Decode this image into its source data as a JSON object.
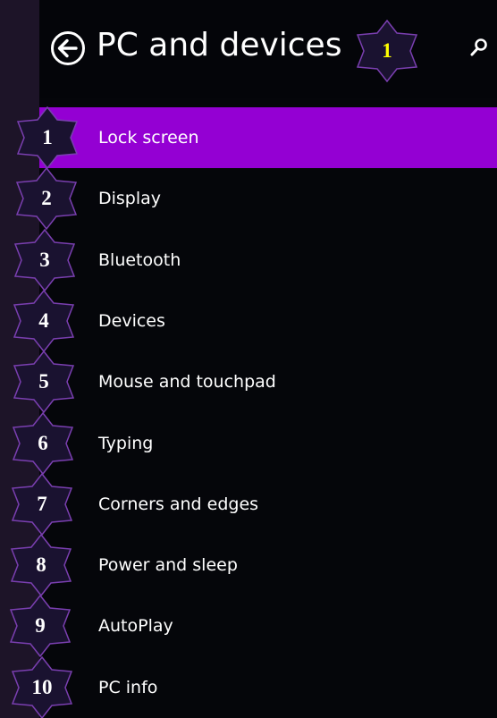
{
  "header": {
    "title": "PC and devices",
    "badge": "1"
  },
  "menu": {
    "items": [
      {
        "label": "Lock screen",
        "badge": "1",
        "selected": true
      },
      {
        "label": "Display",
        "badge": "2",
        "selected": false
      },
      {
        "label": "Bluetooth",
        "badge": "3",
        "selected": false
      },
      {
        "label": "Devices",
        "badge": "4",
        "selected": false
      },
      {
        "label": "Mouse and touchpad",
        "badge": "5",
        "selected": false
      },
      {
        "label": "Typing",
        "badge": "6",
        "selected": false
      },
      {
        "label": "Corners and edges",
        "badge": "7",
        "selected": false
      },
      {
        "label": "Power and sleep",
        "badge": "8",
        "selected": false
      },
      {
        "label": "AutoPlay",
        "badge": "9",
        "selected": false
      },
      {
        "label": "PC info",
        "badge": "10",
        "selected": false
      }
    ]
  },
  "colors": {
    "accent": "#9400d3",
    "background": "#05060a",
    "left_strip": "#1d1428",
    "badge_fill": "#1a1230",
    "badge_stroke": "#7a3fb0",
    "header_badge_text": "#ffff00"
  },
  "icons": {
    "back": "back-arrow-circle-icon",
    "search": "search-icon",
    "badge": "star-badge-icon"
  }
}
